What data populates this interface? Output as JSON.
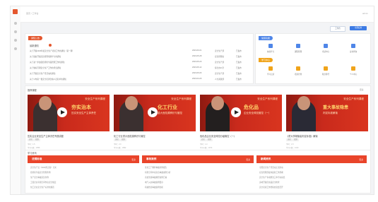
{
  "topbar": {
    "breadcrumb": "首页 / 工作台",
    "user": "admin"
  },
  "actions": {
    "secondary": "工作台",
    "primary": "全部应用"
  },
  "notice": {
    "tag": "通知公告",
    "subtitle": "最新通知",
    "rows": [
      {
        "title": "关于开展2023年度安全生产培训工作的通知（第一期）",
        "date": "2023-06-01",
        "dept": "安全生产部",
        "status": "已发布"
      },
      {
        "title": "关于组织开展应急管理专题学习的通知",
        "date": "2023-05-28",
        "dept": "应急管理处",
        "status": "已发布"
      },
      {
        "title": "关于进一步加强危险化学品管理工作的通知",
        "date": "2023-05-20",
        "dept": "安全生产部",
        "status": "已发布"
      },
      {
        "title": "关于做好汛期安全生产工作的紧急通知",
        "date": "2023-05-12",
        "dept": "综合办公室",
        "status": "已发布"
      },
      {
        "title": "关于开展安全生产月活动的通知",
        "date": "2023-05-06",
        "dept": "安全生产部",
        "status": "已发布"
      },
      {
        "title": "关于公布第一批安全培训合格人员名单的通知",
        "date": "2023-04-29",
        "dept": "人力资源部",
        "status": "已发布"
      }
    ]
  },
  "shortcuts": {
    "tag1": "常用功能",
    "tag2": "学习中心",
    "row1": [
      {
        "label": "在线学习",
        "icon": "book-icon",
        "color": "#4f86e8"
      },
      {
        "label": "课程管理",
        "icon": "folder-icon",
        "color": "#4f86e8"
      },
      {
        "label": "考试中心",
        "icon": "exam-icon",
        "color": "#4f86e8"
      },
      {
        "label": "证书查询",
        "icon": "certificate-icon",
        "color": "#4f86e8"
      }
    ],
    "row2": [
      {
        "label": "学习记录",
        "icon": "record-icon",
        "color": "#f0a41b"
      },
      {
        "label": "培训计划",
        "icon": "calendar-icon",
        "color": "#f0a41b"
      },
      {
        "label": "积分排行",
        "icon": "trophy-icon",
        "color": "#f0a41b"
      },
      {
        "label": "个人中心",
        "icon": "user-icon",
        "color": "#f0a41b"
      }
    ]
  },
  "courses": {
    "section_title": "推荐课程",
    "more": "更多",
    "items": [
      {
        "series": "安全生产系列课程",
        "big": "夯实治本",
        "sub": "压实安全生产主体责任",
        "title": "压实企业安全生产主体责任专题讲座",
        "tags": [
          "必修",
          "视频"
        ],
        "meta1": "学时：1.5",
        "meta2": "学习人数：2356"
      },
      {
        "series": "安全生产系列课程",
        "big": "化工行业",
        "sub": "重大危险源辨识与管控",
        "title": "化工行业重大危险源辨识与管控",
        "tags": [
          "选修",
          "视频"
        ],
        "meta1": "学时：2.0",
        "meta2": "学习人数：1892"
      },
      {
        "series": "安全生产系列课程",
        "big": "危化品",
        "sub": "企业安全风险管控（一）",
        "title": "危化品企业安全风险分级管控（一）",
        "tags": [
          "必修",
          "视频"
        ],
        "meta1": "学时：1.0",
        "meta2": "学习人数：1674"
      },
      {
        "series": "安全生产系列课程",
        "big": "重大事故隐患",
        "sub": "判定标准解读",
        "title": "《重大事故隐患判定标准》解读",
        "tags": [
          "选修",
          "视频"
        ],
        "meta1": "学时：1.5",
        "meta2": "学习人数：1410"
      }
    ]
  },
  "lists": {
    "section_title": "学习资讯",
    "columns": [
      {
        "title": "法规标准",
        "more": "更多",
        "items": [
          "安全生产法（2021修正版）全文",
          "危险化学品安全管理条例",
          "生产安全事故应急条例",
          "工贸企业有限空间作业安全规定",
          "化工企业安全生产标准化规范"
        ]
      },
      {
        "title": "事故案例",
        "more": "更多",
        "items": [
          "某化工厂爆炸事故调查报告",
          "有限空间中毒窒息事故案例分析",
          "高处坠落事故典型案例汇编",
          "电气火灾事故案例警示",
          "机械伤害事故案例剖析"
        ]
      },
      {
        "title": "新闻资讯",
        "more": "更多",
        "items": [
          "全国安全生产月活动正式启动",
          "应急管理部发布最新工作部署",
          "安全生产专项整治三年行动总结",
          "多地开展危化品安全检查",
          "安全培训工作经验交流会召开"
        ]
      }
    ]
  }
}
